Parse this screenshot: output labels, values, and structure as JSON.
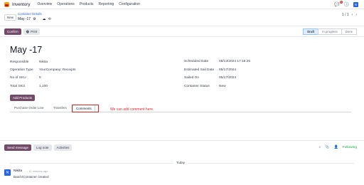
{
  "navbar": {
    "app_name": "Inventory",
    "menu": [
      "Overview",
      "Operations",
      "Products",
      "Reporting",
      "Configuration"
    ],
    "badge_count": "5",
    "avatar_letter": "N"
  },
  "control_panel": {
    "new_label": "New",
    "breadcrumb": "Container Details",
    "record_name": "May -17",
    "pager": "1 / 1"
  },
  "form": {
    "confirm_label": "Confirm",
    "print_label": "Print",
    "statuses": [
      "Draft",
      "In progress",
      "Done"
    ],
    "title": "May -17",
    "left_fields": [
      {
        "label": "Responsible",
        "value": "Nikita"
      },
      {
        "label": "Operation Type",
        "value": "YourCompany: Receipts"
      },
      {
        "label": "No of SKU",
        "value": "5"
      },
      {
        "label": "Total SKU",
        "value": "1,100"
      }
    ],
    "right_fields": [
      {
        "label": "Scheduled Date",
        "value": "05/13/2024 17:18:26"
      },
      {
        "label": "Estimated Sail Date",
        "value": "05/17/2024"
      },
      {
        "label": "Sailed On",
        "value": "05/17/2024"
      },
      {
        "label": "Container Status",
        "value": "New"
      }
    ],
    "add_products_label": "Add Products",
    "tabs": [
      "Purchase Order Line",
      "Transfers",
      "Comments"
    ],
    "annotation": "We can add comment here."
  },
  "chatter": {
    "send_message": "Send message",
    "log_note": "Log note",
    "activities": "Activities",
    "following": "Following",
    "today": "Today",
    "message": {
      "avatar_letter": "N",
      "author": "Nikita",
      "time": "- 11 minutes ago",
      "body": "Batch/Container created"
    }
  },
  "colors": {
    "brand": "#714b67",
    "annotation": "#dc2626",
    "following": "#16a34a",
    "avatar": "#2563eb"
  }
}
